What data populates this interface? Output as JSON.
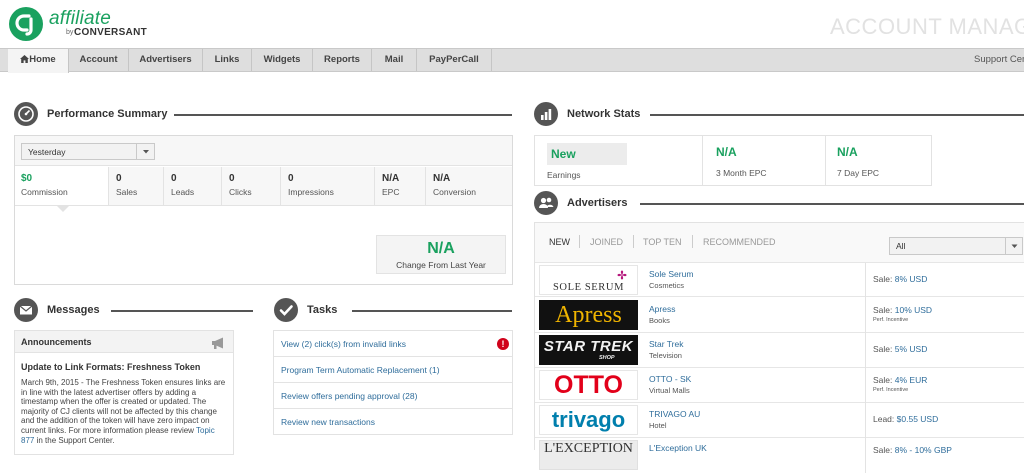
{
  "brand": {
    "word": "affiliate",
    "by": "by",
    "company": "CONVERSANT",
    "logo_icon": "cj-logo-icon"
  },
  "page_title": "ACCOUNT MANAGER",
  "nav": {
    "items": [
      "Home",
      "Account",
      "Advertisers",
      "Links",
      "Widgets",
      "Reports",
      "Mail",
      "PayPerCall"
    ],
    "active": "Home",
    "support": "Support Center"
  },
  "performance": {
    "title": "Performance Summary",
    "period": "Yesterday",
    "stats": [
      {
        "value": "$0",
        "label": "Commission"
      },
      {
        "value": "0",
        "label": "Sales"
      },
      {
        "value": "0",
        "label": "Leads"
      },
      {
        "value": "0",
        "label": "Clicks"
      },
      {
        "value": "0",
        "label": "Impressions"
      },
      {
        "value": "N/A",
        "label": "EPC"
      },
      {
        "value": "N/A",
        "label": "Conversion"
      }
    ],
    "change": {
      "value": "N/A",
      "label": "Change From Last Year"
    }
  },
  "messages": {
    "title": "Messages",
    "announcements_label": "Announcements",
    "headline": "Update to Link Formats: Freshness Token",
    "body": "March 9th, 2015 - The Freshness Token ensures links are in line with the latest advertiser offers by adding a timestamp when the offer is created or updated. The majority of CJ clients will not be affected by this change and the addition of the token will have zero impact on current links. For more information please review",
    "link": "Topic 877",
    "tail": " in the Support Center."
  },
  "tasks": {
    "title": "Tasks",
    "items": [
      "View (2) click(s) from invalid links",
      "Program Term Automatic Replacement (1)",
      "Review offers pending approval (28)",
      "Review new transactions"
    ],
    "alert_glyph": "!"
  },
  "network": {
    "title": "Network Stats",
    "stats": [
      {
        "value": "New",
        "label": "Earnings"
      },
      {
        "value": "N/A",
        "label": "3 Month EPC"
      },
      {
        "value": "N/A",
        "label": "7 Day EPC"
      }
    ]
  },
  "advertisers": {
    "title": "Advertisers",
    "tabs": [
      "NEW",
      "JOINED",
      "TOP TEN",
      "RECOMMENDED"
    ],
    "active_tab": "NEW",
    "filter": "All",
    "rows": [
      {
        "logo": "SOLE SERUM",
        "name": "Sole Serum",
        "category": "Cosmetics",
        "rate_label": "Sale:",
        "rate": "8% USD",
        "note": ""
      },
      {
        "logo": "Apress",
        "name": "Apress",
        "category": "Books",
        "rate_label": "Sale:",
        "rate": "10% USD",
        "note": "Perf. Incentive"
      },
      {
        "logo": "STAR TREK",
        "logo_sub": "SHOP",
        "name": "Star Trek",
        "category": "Television",
        "rate_label": "Sale:",
        "rate": "5% USD",
        "note": ""
      },
      {
        "logo": "OTTO",
        "name": "OTTO - SK",
        "category": "Virtual Malls",
        "rate_label": "Sale:",
        "rate": "4% EUR",
        "note": "Perf. Incentive"
      },
      {
        "logo": "trivago",
        "name": "TRIVAGO AU",
        "category": "Hotel",
        "rate_label": "Lead:",
        "rate": "$0.55 USD",
        "note": ""
      },
      {
        "logo": "L'EXCEPTION",
        "name": "L'Exception UK",
        "category": "",
        "rate_label": "Sale:",
        "rate": "8% - 10% GBP",
        "note": ""
      }
    ]
  },
  "colors": {
    "brand_green": "#1aa15f",
    "link_blue": "#2f6d9b",
    "alert_red": "#d0021b",
    "otto_red": "#e2001a",
    "trivago_blue": "#007fad"
  }
}
